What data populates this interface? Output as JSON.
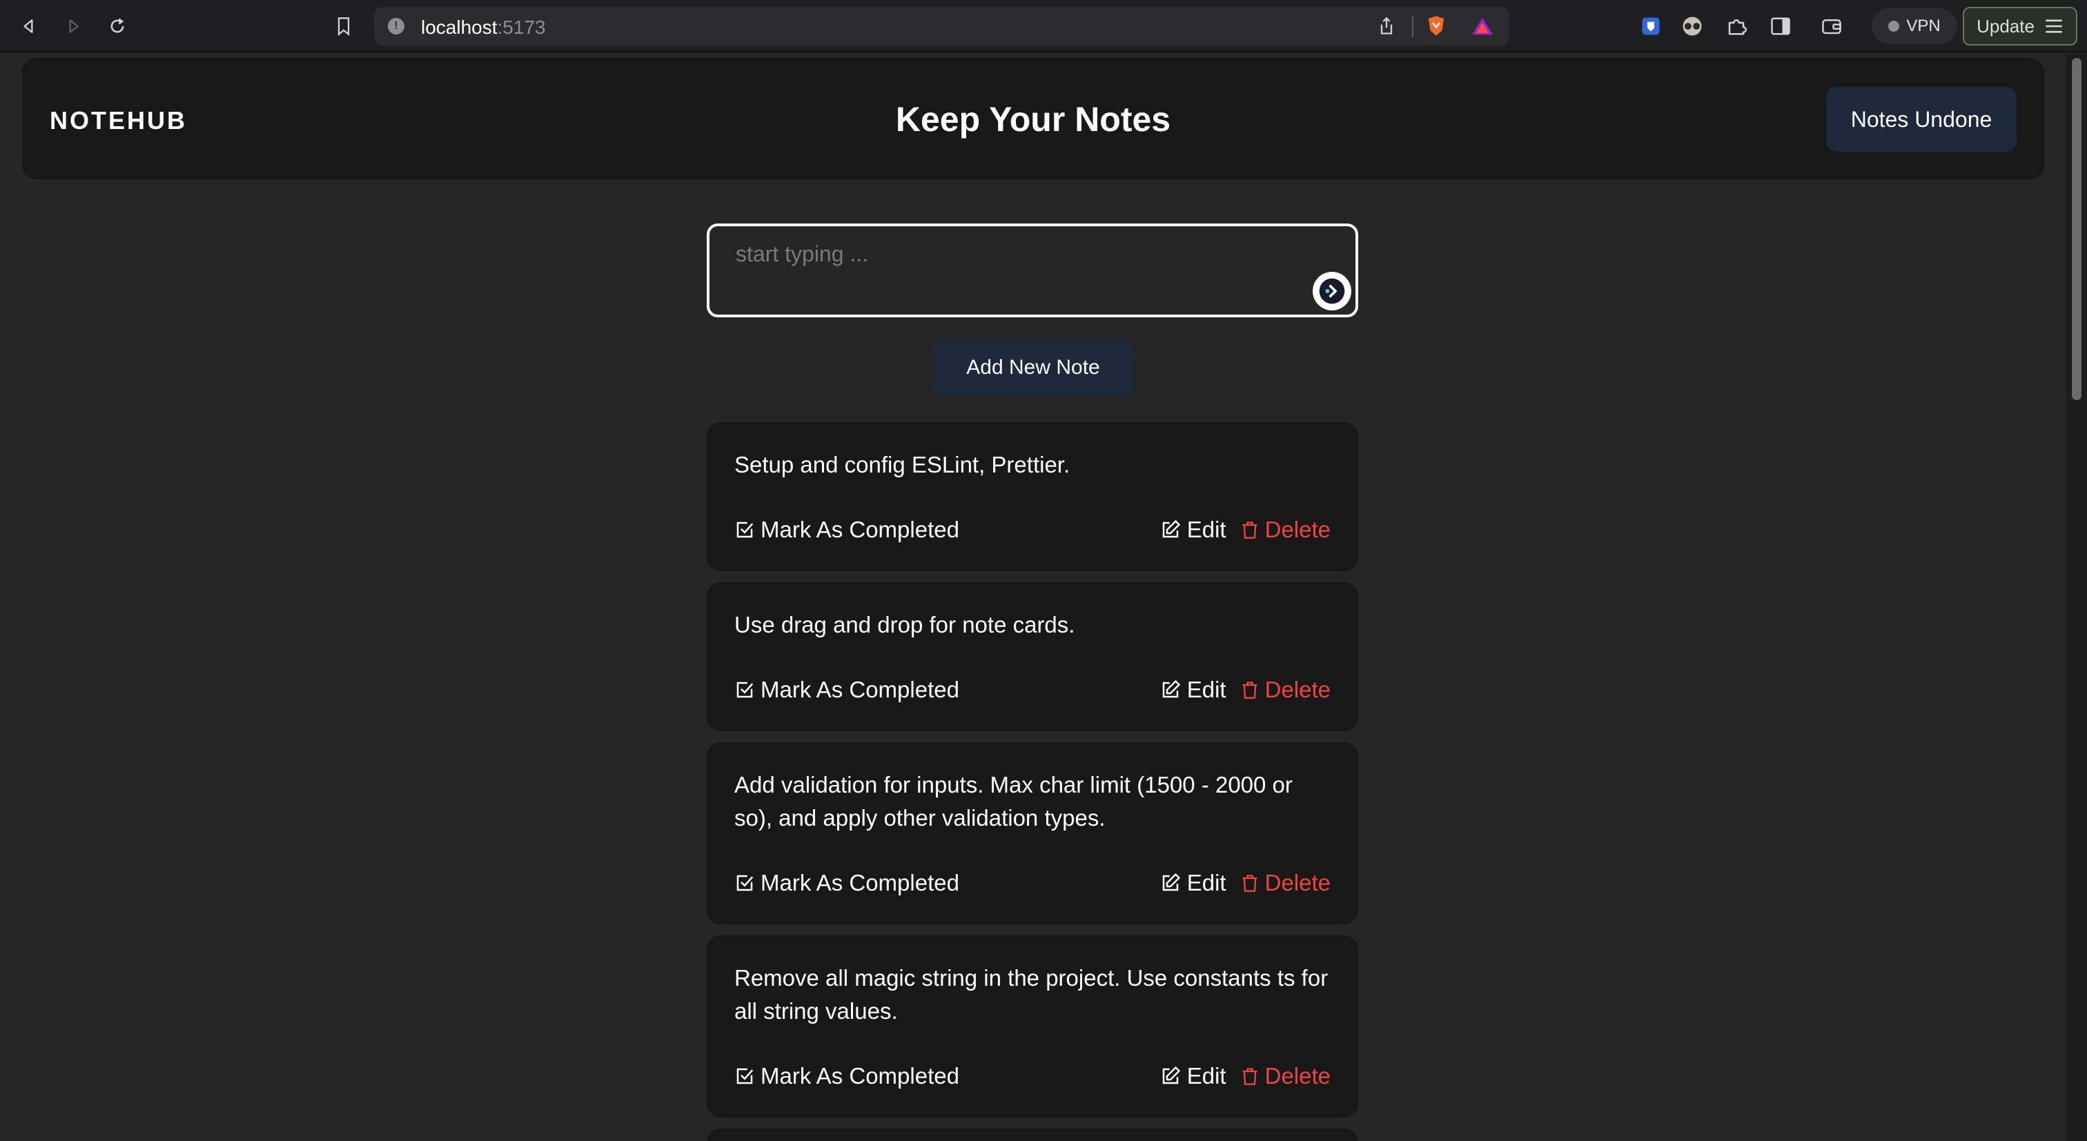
{
  "browser": {
    "url_host": "localhost",
    "url_port": ":5173",
    "vpn_label": "VPN",
    "update_label": "Update"
  },
  "header": {
    "logo": "NOTEHUB",
    "title": "Keep Your Notes",
    "undone_button": "Notes Undone"
  },
  "composer": {
    "placeholder": "start typing ...",
    "add_button": "Add New Note"
  },
  "actions": {
    "complete": "Mark As Completed",
    "edit": "Edit",
    "delete": "Delete"
  },
  "notes": [
    {
      "text": "Setup and config ESLint, Prettier."
    },
    {
      "text": "Use drag and drop for note cards."
    },
    {
      "text": "Add validation for inputs. Max char limit (1500 - 2000 or so), and apply other validation types."
    },
    {
      "text": "Remove all magic string in the project. Use constants ts for all string values."
    }
  ],
  "colors": {
    "background": "#262626",
    "card": "#181818",
    "button": "#1e293b",
    "delete": "#ef4444"
  }
}
